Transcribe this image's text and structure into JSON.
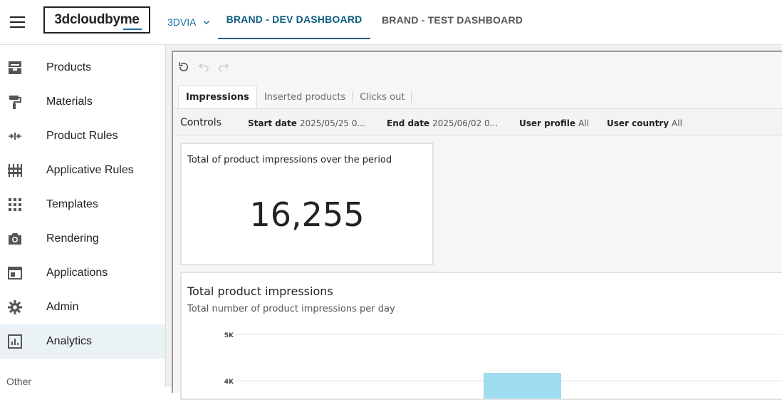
{
  "header": {
    "logo": "3dcloudbyme",
    "tenant": "3DVIA",
    "tabs": [
      {
        "label": "BRAND - DEV DASHBOARD",
        "active": true
      },
      {
        "label": "BRAND - TEST DASHBOARD",
        "active": false
      }
    ]
  },
  "sidebar": {
    "items": [
      {
        "label": "Products",
        "icon": "products-icon"
      },
      {
        "label": "Materials",
        "icon": "paint-roller-icon"
      },
      {
        "label": "Product Rules",
        "icon": "arrows-merge-icon"
      },
      {
        "label": "Applicative Rules",
        "icon": "sliders-icon"
      },
      {
        "label": "Templates",
        "icon": "grid-icon"
      },
      {
        "label": "Rendering",
        "icon": "camera-icon"
      },
      {
        "label": "Applications",
        "icon": "browser-window-icon"
      },
      {
        "label": "Admin",
        "icon": "gear-icon"
      },
      {
        "label": "Analytics",
        "icon": "analytics-icon",
        "active": true
      }
    ],
    "other_label": "Other"
  },
  "dashboard": {
    "sheet_tabs": [
      {
        "label": "Impressions",
        "active": true
      },
      {
        "label": "Inserted products",
        "active": false
      },
      {
        "label": "Clicks out",
        "active": false
      }
    ],
    "controls": {
      "title": "Controls",
      "start_date": {
        "label": "Start date",
        "value": "2025/05/25 0..."
      },
      "end_date": {
        "label": "End date",
        "value": "2025/06/02 0..."
      },
      "user_profile": {
        "label": "User profile",
        "value": "All"
      },
      "user_country": {
        "label": "User country",
        "value": "All"
      }
    },
    "kpi": {
      "title": "Total of product impressions over the period",
      "value": "16,255"
    },
    "chart": {
      "title": "Total product impressions",
      "subtitle": "Total number of product impressions per day"
    }
  },
  "chart_data": {
    "type": "bar",
    "title": "Total product impressions",
    "subtitle": "Total number of product impressions per day",
    "y_ticks": [
      "5K",
      "4K"
    ],
    "visible_bar_value_min": 4000,
    "bar_color": "#9fdcf0",
    "grid": true
  },
  "colors": {
    "accent": "#0b5c80",
    "tenant": "#1a6fa3",
    "active_nav_bg": "#eaf2f6"
  }
}
